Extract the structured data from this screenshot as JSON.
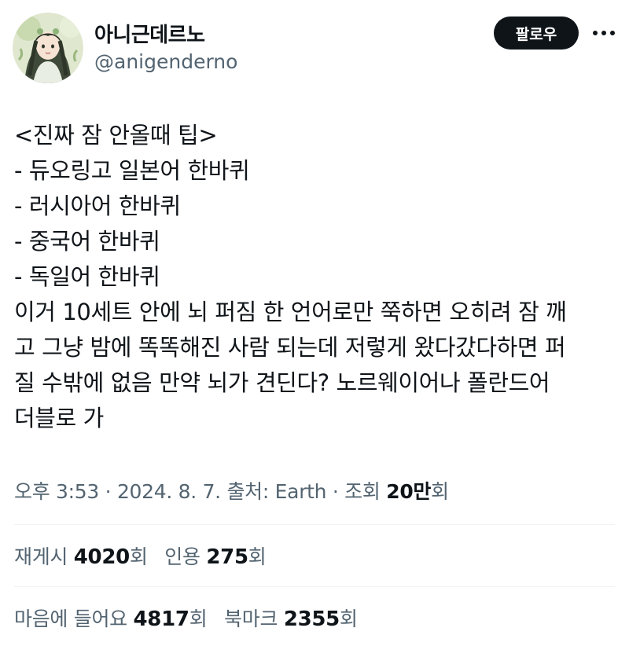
{
  "author": {
    "display_name": "아니근데르노",
    "handle": "@anigenderno",
    "avatar": "anime-girl-portrait"
  },
  "actions": {
    "follow_label": "팔로우",
    "more_icon": "more-horizontal-icon"
  },
  "tweet": {
    "lines": [
      "<진짜 잠 안올때 팁>",
      "- 듀오링고 일본어 한바퀴",
      "- 러시아어 한바퀴",
      "- 중국어 한바퀴",
      "- 독일어 한바퀴",
      "이거 10세트 안에 뇌 퍼짐 한 언어로만 쭉하면 오히려 잠 깨",
      "고 그냥 밤에 똑똑해진 사람 되는데 저렇게 왔다갔다하면 퍼",
      "질 수밖에 없음 만약 뇌가 견딘다? 노르웨이어나 폴란드어",
      "더블로 가"
    ]
  },
  "meta": {
    "time": "오후 3:53",
    "separator": " · ",
    "date": "2024. 8. 7.",
    "source_label": "출처:",
    "source": "Earth",
    "views_label": "조회",
    "views_count": "20만",
    "views_suffix": "회"
  },
  "stats": {
    "reposts_label": "재게시",
    "reposts_count": "4020",
    "quotes_label": "인용",
    "quotes_count": "275",
    "likes_label": "마음에 들어요",
    "likes_count": "4817",
    "bookmarks_label": "북마크",
    "bookmarks_count": "2355",
    "count_suffix": "회"
  },
  "colors": {
    "text": "#0f1419",
    "secondary": "#536471",
    "divider": "#eff3f4",
    "button_bg": "#0f1419",
    "button_text": "#ffffff"
  }
}
